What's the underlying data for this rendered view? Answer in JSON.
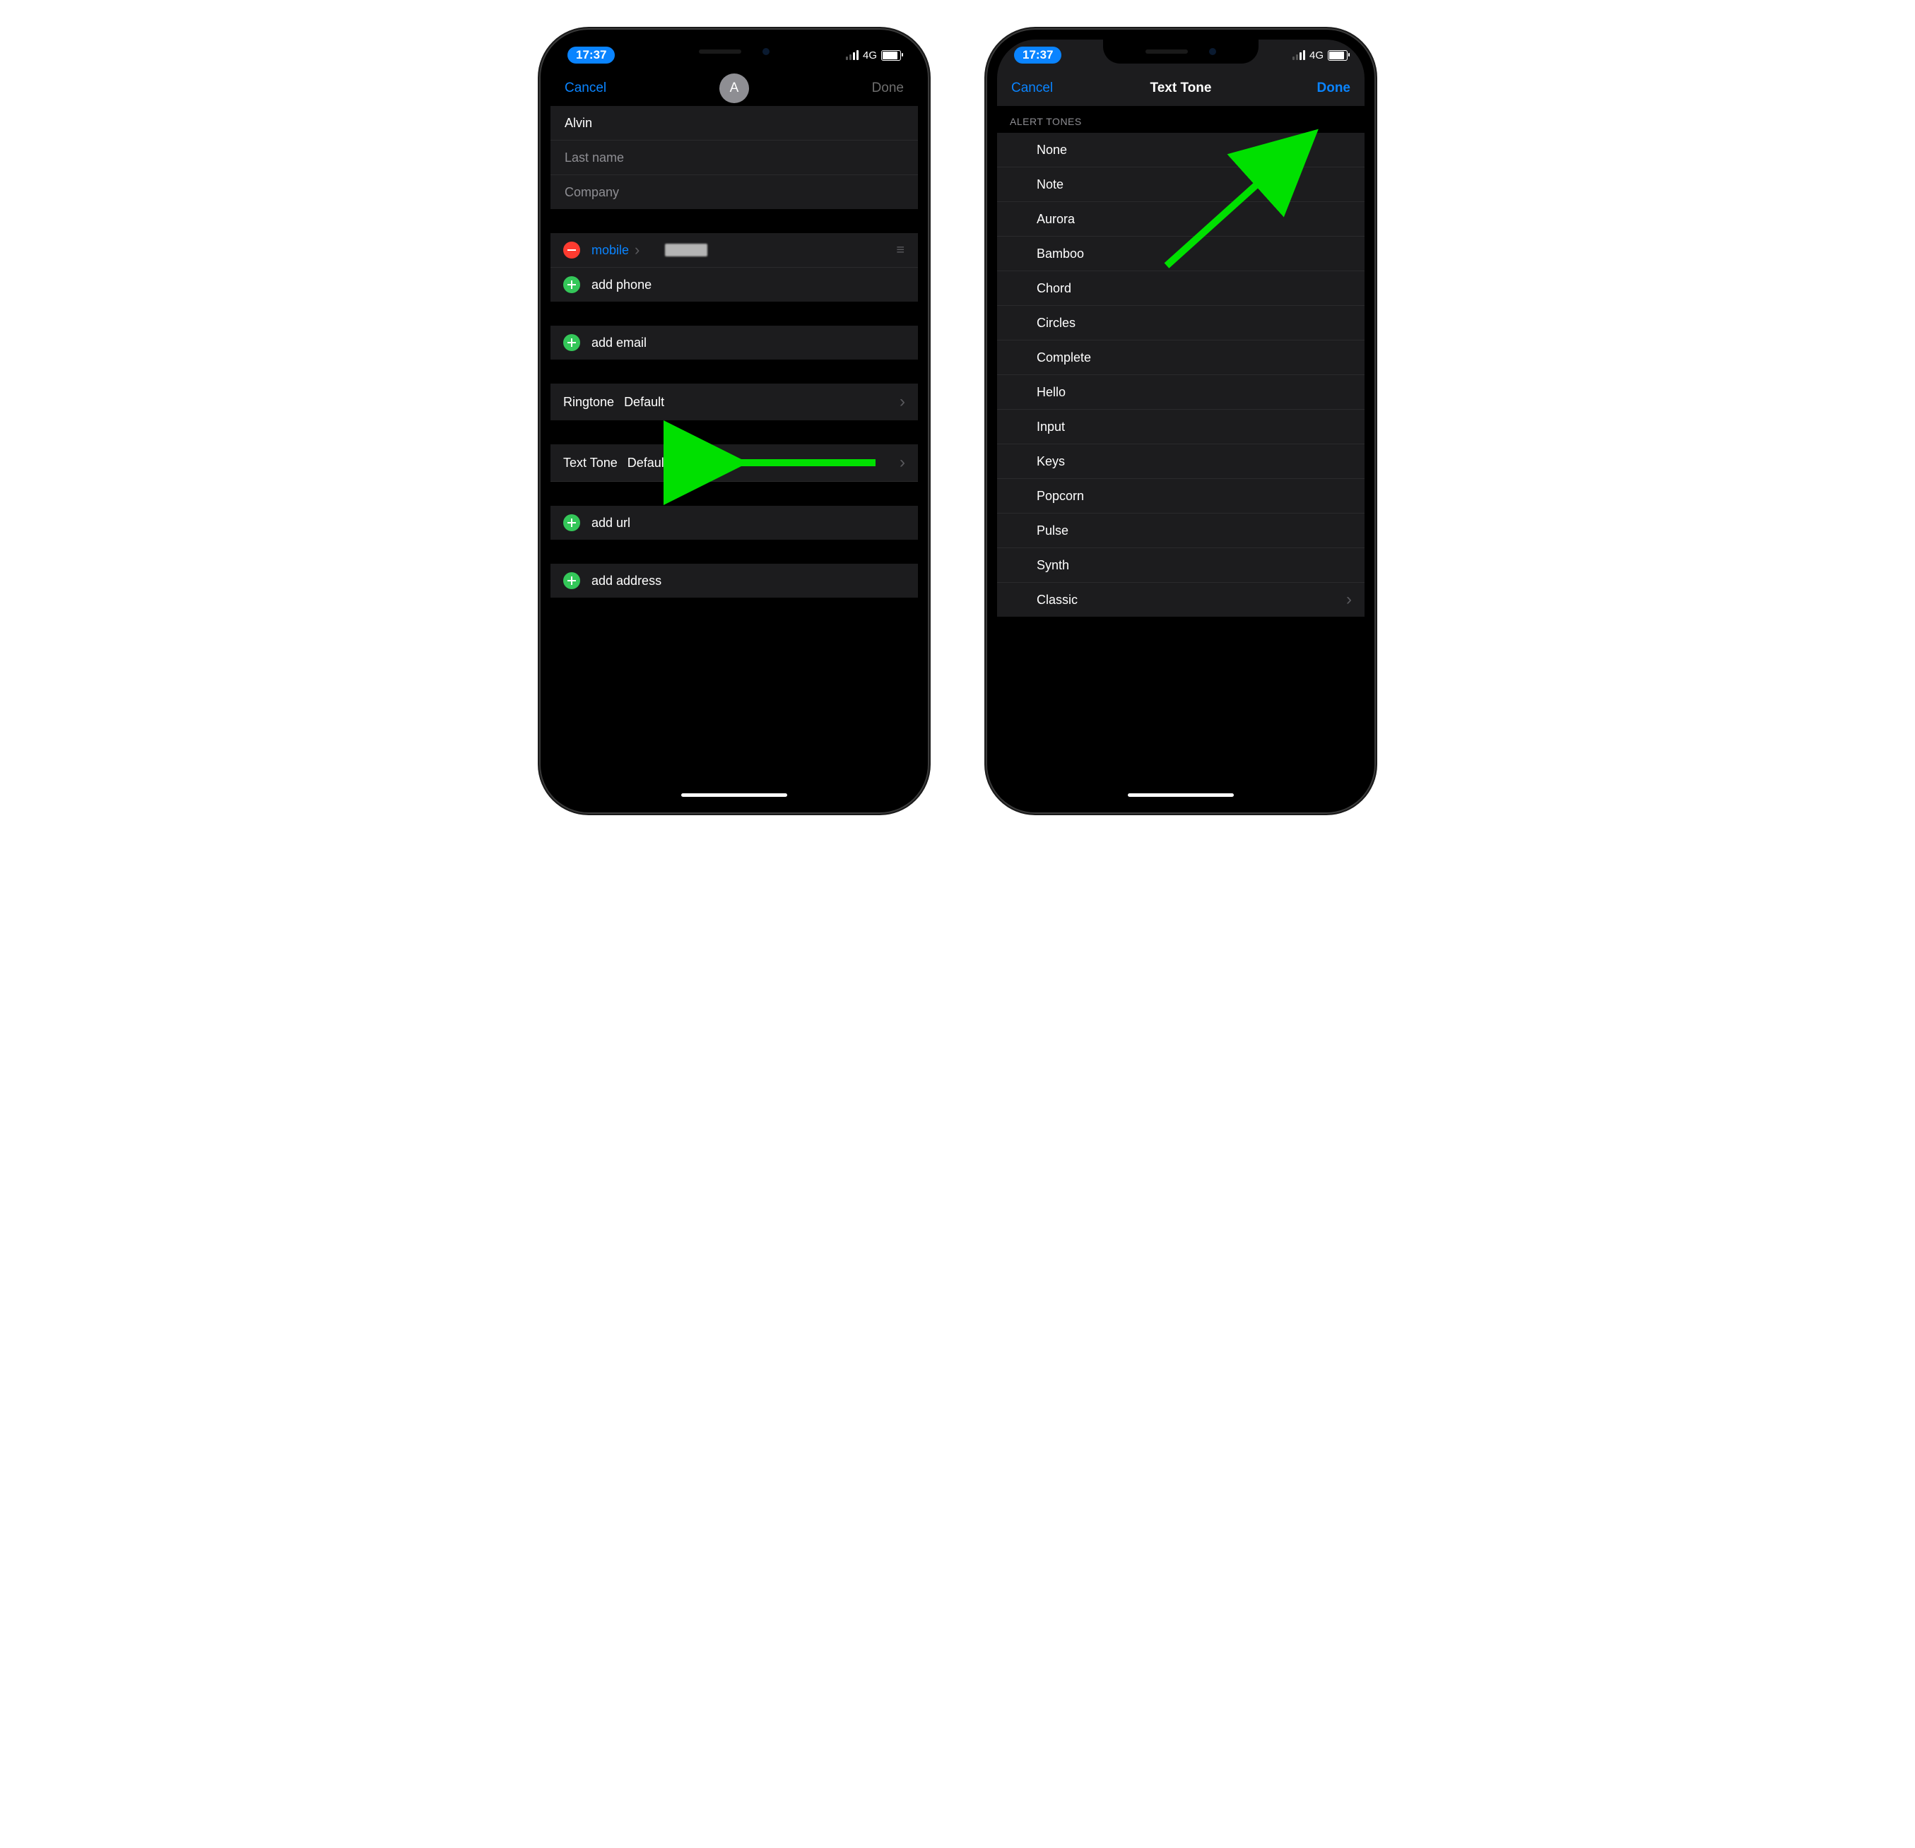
{
  "status": {
    "time": "17:37",
    "network": "4G"
  },
  "left": {
    "nav": {
      "cancel": "Cancel",
      "done": "Done",
      "avatar_initial": "A"
    },
    "name_fields": {
      "first_value": "Alvin",
      "last_placeholder": "Last name",
      "company_placeholder": "Company"
    },
    "phone": {
      "type_label": "mobile",
      "add_label": "add phone"
    },
    "email": {
      "add_label": "add email"
    },
    "ringtone": {
      "label": "Ringtone",
      "value": "Default"
    },
    "texttone": {
      "label": "Text Tone",
      "value": "Default"
    },
    "url": {
      "add_label": "add url"
    },
    "address": {
      "add_label": "add address"
    }
  },
  "right": {
    "nav": {
      "cancel": "Cancel",
      "title": "Text Tone",
      "done": "Done"
    },
    "section_header": "Alert Tones",
    "tones": [
      "None",
      "Note",
      "Aurora",
      "Bamboo",
      "Chord",
      "Circles",
      "Complete",
      "Hello",
      "Input",
      "Keys",
      "Popcorn",
      "Pulse",
      "Synth",
      "Classic"
    ]
  }
}
